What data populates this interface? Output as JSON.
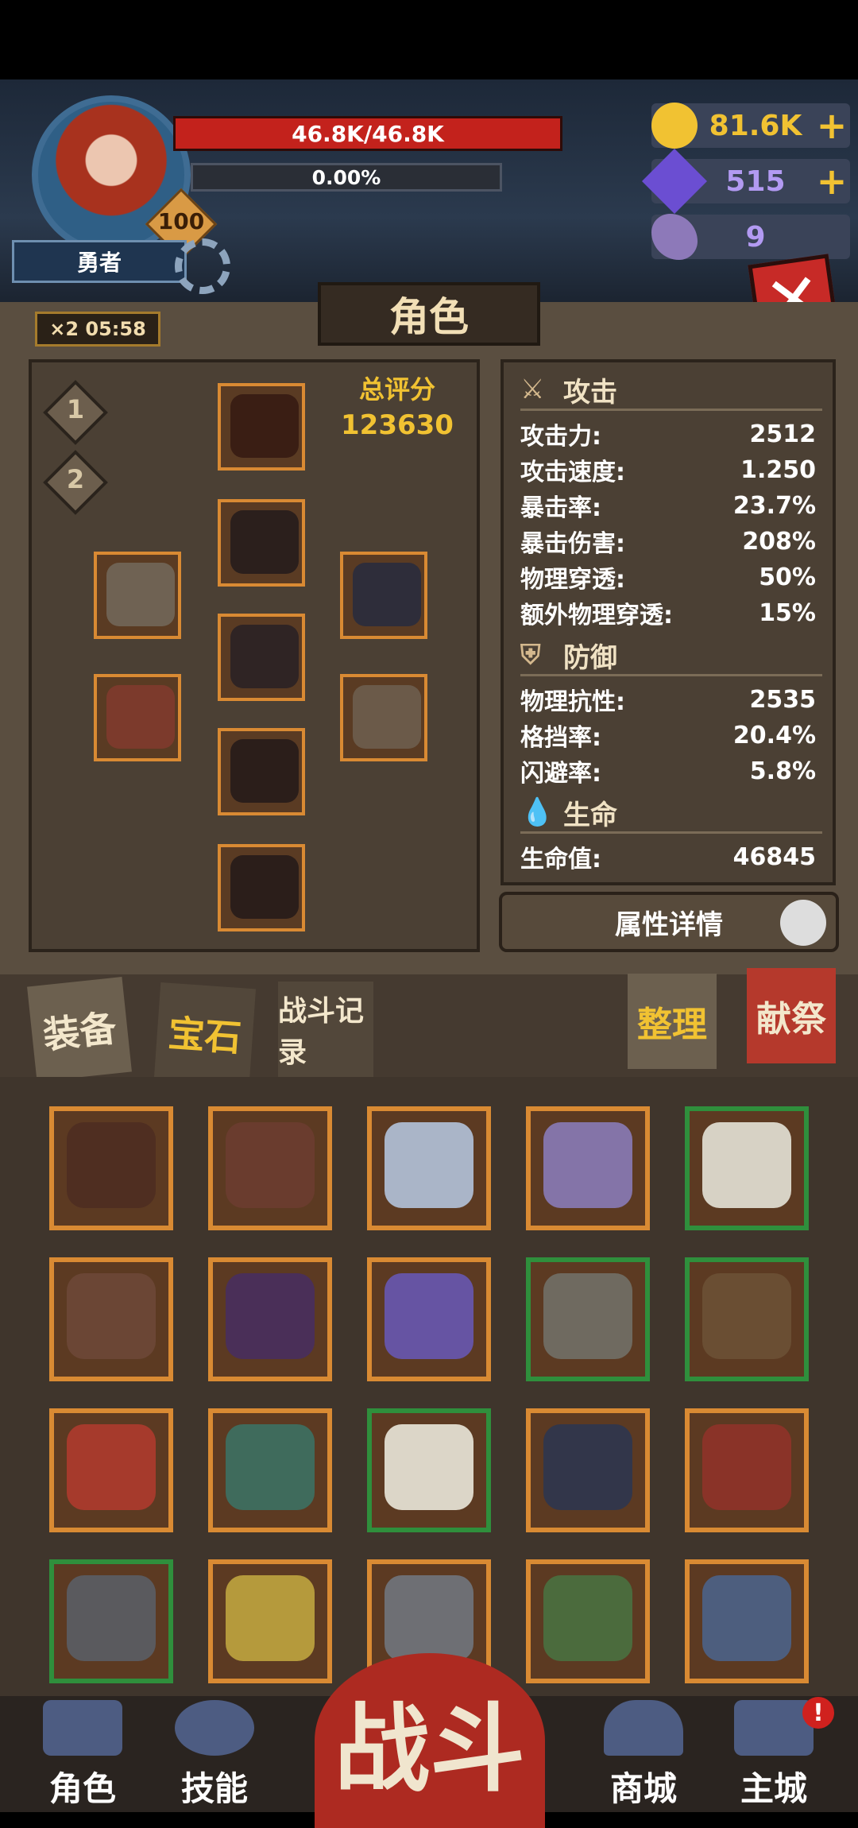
{
  "header": {
    "hp": "46.8K/46.8K",
    "xp": "0.00%",
    "level": "100",
    "name": "勇者"
  },
  "resources": {
    "gold": "81.6K",
    "gems": "515",
    "horn": "9"
  },
  "panel": {
    "title": "角色",
    "timer": "×2 05:58",
    "loadout_1": "1",
    "loadout_2": "2",
    "score_label": "总评分",
    "score_value": "123630"
  },
  "stats": {
    "attack_header": "攻击",
    "attack_rows": [
      {
        "label": "攻击力:",
        "value": "2512"
      },
      {
        "label": "攻击速度:",
        "value": "1.250"
      },
      {
        "label": "暴击率:",
        "value": "23.7%"
      },
      {
        "label": "暴击伤害:",
        "value": "208%"
      },
      {
        "label": "物理穿透:",
        "value": "50%"
      },
      {
        "label": "额外物理穿透:",
        "value": "15%"
      }
    ],
    "defense_header": "防御",
    "defense_rows": [
      {
        "label": "物理抗性:",
        "value": "2535"
      },
      {
        "label": "格挡率:",
        "value": "20.4%"
      },
      {
        "label": "闪避率:",
        "value": "5.8%"
      }
    ],
    "life_header": "生命",
    "life_rows": [
      {
        "label": "生命值:",
        "value": "46845"
      }
    ],
    "detail_button": "属性详情"
  },
  "tabs": {
    "equip": "装备",
    "gem": "宝石",
    "battle_record": "战斗记录",
    "organize": "整理",
    "sacrifice": "献祭"
  },
  "nav": {
    "role": "角色",
    "skill": "技能",
    "fight": "战斗",
    "shop": "商城",
    "city": "主城",
    "alert": "!"
  },
  "colors": {
    "accent_gold": "#f1c232",
    "hp_red": "#c3221c",
    "panel_brown": "#5a4e40",
    "slot_orange": "#d98a33",
    "slot_green": "#2f8f3c"
  }
}
